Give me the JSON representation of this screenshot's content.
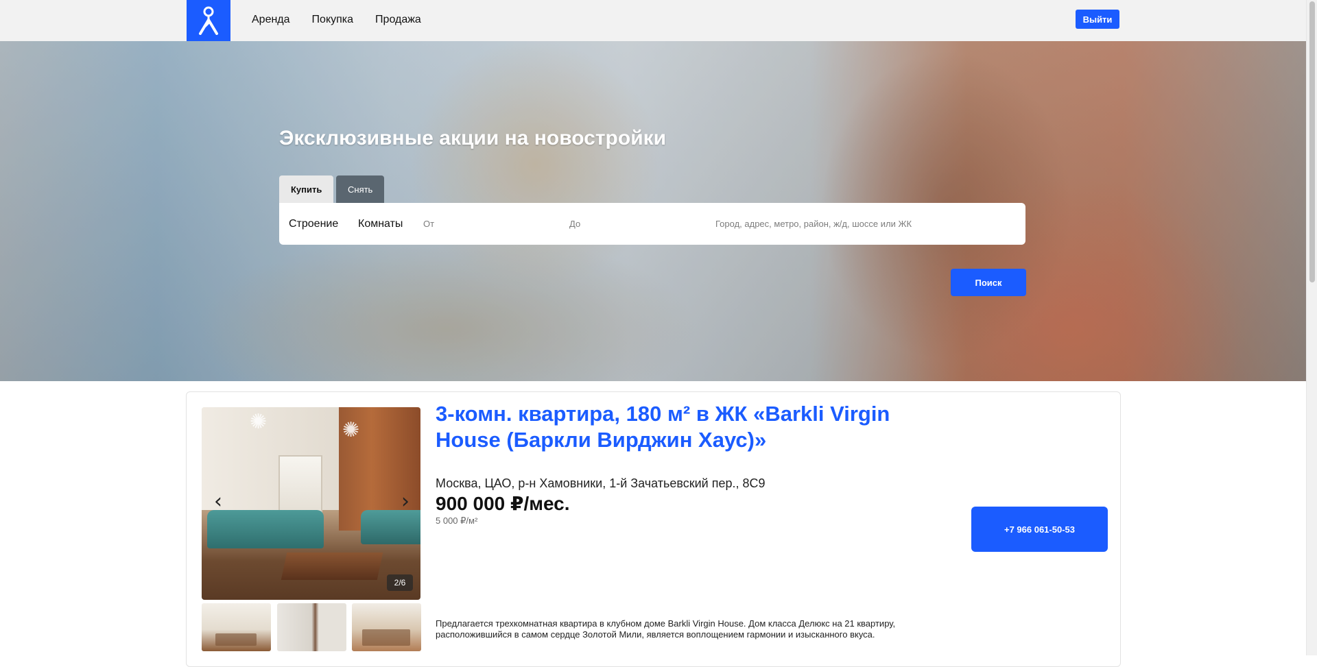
{
  "header": {
    "logo_icon": "map-pin-person-logo",
    "nav": [
      "Аренда",
      "Покупка",
      "Продажа"
    ],
    "logout_label": "Выйти"
  },
  "hero": {
    "title": "Эксклюзивные акции на новостройки",
    "tabs": [
      {
        "label": "Купить",
        "active": true
      },
      {
        "label": "Снять",
        "active": false
      }
    ],
    "filters": {
      "building_label": "Строение",
      "rooms_label": "Комнаты",
      "from_placeholder": "От",
      "to_placeholder": "До",
      "location_placeholder": "Город, адрес, метро, район, ж/д, шоссе или ЖК"
    },
    "search_label": "Поиск"
  },
  "listing": {
    "title": "3-комн. квартира, 180 м² в ЖК «Barkli Virgin House (Баркли Вирджин Хаус)»",
    "address": "Москва, ЦАО, р-н Хамовники, 1-й Зачатьевский пер., 8С9",
    "price": "900 000 ₽/мес.",
    "price_per_m2": "5 000 ₽/м²",
    "phone": "+7 966 061-50-53",
    "gallery_counter": "2/6",
    "description": "Предлагается трехкомнатная квартира в клубном доме Barkli Virgin House. Дом класса Делюкс на 21 квартиру, расположившийся в самом сердце Золотой Мили, является воплощением гармонии и изысканного вкуса."
  },
  "colors": {
    "accent": "#1b5cff",
    "tab_inactive": "#5a6670",
    "header_bg": "#f2f2f2"
  }
}
